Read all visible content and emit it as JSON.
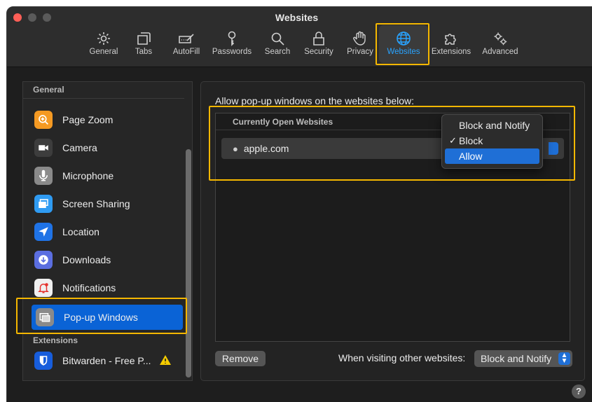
{
  "window": {
    "title": "Websites"
  },
  "toolbar": {
    "items": [
      {
        "label": "General",
        "icon": "gear-icon"
      },
      {
        "label": "Tabs",
        "icon": "tabs-icon"
      },
      {
        "label": "AutoFill",
        "icon": "pencil-field-icon"
      },
      {
        "label": "Passwords",
        "icon": "key-icon"
      },
      {
        "label": "Search",
        "icon": "magnifier-icon"
      },
      {
        "label": "Security",
        "icon": "lock-icon"
      },
      {
        "label": "Privacy",
        "icon": "hand-icon"
      },
      {
        "label": "Websites",
        "icon": "globe-icon",
        "active": true
      },
      {
        "label": "Extensions",
        "icon": "puzzle-icon"
      },
      {
        "label": "Advanced",
        "icon": "gears-icon"
      }
    ],
    "active_color": "#29a3ff"
  },
  "sidebar": {
    "section_general": "General",
    "section_extensions": "Extensions",
    "items": [
      {
        "label": "Page Zoom",
        "icon": "magnifier-plus-icon",
        "color": "#f59a23"
      },
      {
        "label": "Camera",
        "icon": "camera-icon",
        "color": "#3d3d3d"
      },
      {
        "label": "Microphone",
        "icon": "microphone-icon",
        "color": "#8a8a8a"
      },
      {
        "label": "Screen Sharing",
        "icon": "screen-sharing-icon",
        "color": "#2f9bf2"
      },
      {
        "label": "Location",
        "icon": "location-arrow-icon",
        "color": "#1f73e6"
      },
      {
        "label": "Downloads",
        "icon": "download-icon",
        "color": "#5b6ee0"
      },
      {
        "label": "Notifications",
        "icon": "bell-icon",
        "color": "#f0f0f0"
      },
      {
        "label": "Pop-up Windows",
        "icon": "popup-windows-icon",
        "color": "#8a8a8a",
        "selected": true
      }
    ],
    "extensions": [
      {
        "label": "Bitwarden - Free P...",
        "icon": "bitwarden-shield-icon",
        "color": "#175ddc",
        "warning": "warning-triangle-icon"
      }
    ]
  },
  "main": {
    "prompt": "Allow pop-up windows on the websites below:",
    "table_header": "Currently Open Websites",
    "rows": [
      {
        "site": "apple.com",
        "setting": "Allow"
      }
    ],
    "menu": {
      "options": [
        "Block and Notify",
        "Block",
        "Allow"
      ],
      "checked": "Block",
      "highlighted": "Allow"
    },
    "remove_label": "Remove",
    "other_label": "When visiting other websites:",
    "other_value": "Block and Notify",
    "help": "?"
  },
  "colors": {
    "accent": "#0a63d6",
    "annotation": "#f5b700"
  }
}
